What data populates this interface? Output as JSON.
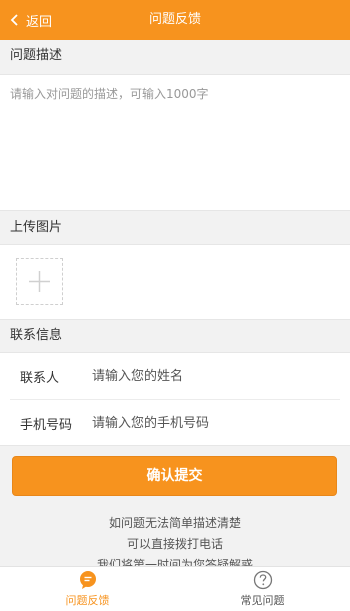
{
  "header": {
    "back_label": "返回",
    "title": "问题反馈"
  },
  "description": {
    "section_title": "问题描述",
    "placeholder": "请输入对问题的描述，可输入1000字"
  },
  "upload": {
    "section_title": "上传图片"
  },
  "contact": {
    "section_title": "联系信息",
    "name_label": "联系人",
    "name_placeholder": "请输入您的姓名",
    "phone_label": "手机号码",
    "phone_placeholder": "请输入您的手机号码"
  },
  "submit_label": "确认提交",
  "help_lines": [
    "如问题无法简单描述清楚",
    "可以直接拨打电话",
    "我们将第一时间为您答疑解惑"
  ],
  "tabs": [
    {
      "label": "问题反馈",
      "icon": "chat-bubble-icon",
      "active": true
    },
    {
      "label": "常见问题",
      "icon": "question-circle-icon",
      "active": false
    }
  ],
  "colors": {
    "accent": "#f7931e",
    "background": "#f2f2f2"
  }
}
